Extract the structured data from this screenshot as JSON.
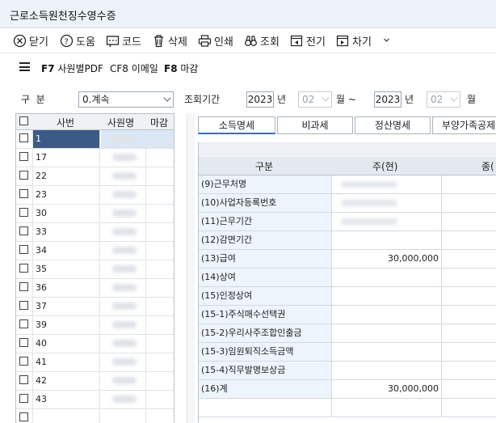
{
  "window": {
    "title": "근로소득원천징수영수증"
  },
  "toolbar": {
    "close": "닫기",
    "help": "도움",
    "code": "코드",
    "delete": "삭제",
    "print": "인쇄",
    "search": "조회",
    "prev": "전기",
    "next": "차기"
  },
  "fkeys": {
    "f7_key": "F7",
    "f7_label": "사원별PDF",
    "cf8": "CF8 이메일",
    "f8_key": "F8",
    "f8_label": "마감"
  },
  "filters": {
    "gubun_label": "구  분",
    "gubun_value": "0.계속",
    "period_label": "조회기간",
    "from_year": "2023",
    "year_unit": "년",
    "from_month": "02",
    "month_unit": "월 ~",
    "to_year": "2023",
    "to_year_unit": "년",
    "to_month": "02",
    "to_month_unit": "월"
  },
  "left_grid": {
    "headers": {
      "sabun": "사번",
      "name": "사원명",
      "close": "마감"
    },
    "rows": [
      "1",
      "17",
      "22",
      "23",
      "30",
      "33",
      "34",
      "35",
      "36",
      "37",
      "39",
      "40",
      "41",
      "42",
      "43"
    ]
  },
  "tabs": [
    "소득명세",
    "비과세",
    "정산명세",
    "부양가족공제"
  ],
  "right_grid": {
    "headers": {
      "gubun": "구분",
      "main": "주(현)",
      "sub": "종("
    },
    "rows": [
      {
        "label": "(9)근무처명",
        "value": ""
      },
      {
        "label": "(10)사업자등록번호",
        "value": ""
      },
      {
        "label": "(11)근무기간",
        "value": ""
      },
      {
        "label": "(12)감면기간",
        "value": ""
      },
      {
        "label": "(13)급여",
        "value": "30,000,000"
      },
      {
        "label": "(14)상여",
        "value": ""
      },
      {
        "label": "(15)인정상여",
        "value": ""
      },
      {
        "label": "(15-1)주식매수선택권",
        "value": ""
      },
      {
        "label": "(15-2)우리사주조합인출금",
        "value": ""
      },
      {
        "label": "(15-3)임원퇴직소득금액",
        "value": ""
      },
      {
        "label": "(15-4)직무발명보상금",
        "value": ""
      },
      {
        "label": "(16)계",
        "value": "30,000,000"
      }
    ]
  }
}
